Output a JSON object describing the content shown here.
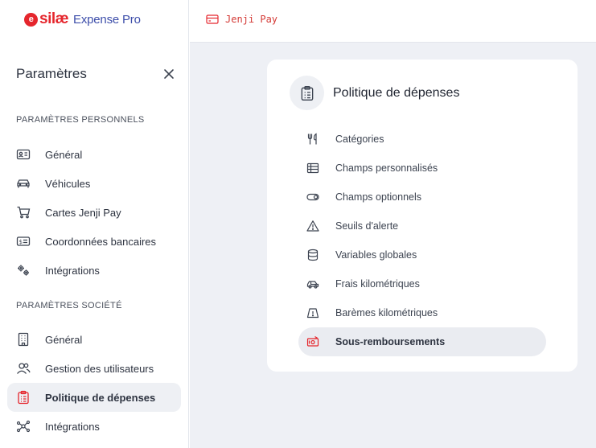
{
  "logo": {
    "mark": "silæ",
    "product": "Expense Pro"
  },
  "sidebar": {
    "title": "Paramètres",
    "personal_label": "PARAMÈTRES PERSONNELS",
    "personal_items": [
      {
        "label": "Général",
        "icon": "id-card-icon"
      },
      {
        "label": "Véhicules",
        "icon": "car-icon"
      },
      {
        "label": "Cartes Jenji Pay",
        "icon": "cart-icon"
      },
      {
        "label": "Coordonnées bancaires",
        "icon": "bank-note-icon"
      },
      {
        "label": "Intégrations",
        "icon": "gears-icon"
      }
    ],
    "company_label": "PARAMÈTRES SOCIÉTÉ",
    "company_items": [
      {
        "label": "Général",
        "icon": "building-icon"
      },
      {
        "label": "Gestion des utilisateurs",
        "icon": "users-icon"
      },
      {
        "label": "Politique de dépenses",
        "icon": "clipboard-icon",
        "active": true
      },
      {
        "label": "Intégrations",
        "icon": "network-icon"
      }
    ]
  },
  "topbar": {
    "crumb": "Jenji Pay"
  },
  "card": {
    "title": "Politique de dépenses",
    "items": [
      {
        "label": "Catégories",
        "icon": "fork-knife-icon"
      },
      {
        "label": "Champs personnalisés",
        "icon": "table-icon"
      },
      {
        "label": "Champs optionnels",
        "icon": "toggle-icon"
      },
      {
        "label": "Seuils d'alerte",
        "icon": "warning-icon"
      },
      {
        "label": "Variables globales",
        "icon": "database-icon"
      },
      {
        "label": "Frais kilométriques",
        "icon": "car-front-icon"
      },
      {
        "label": "Barèmes kilométriques",
        "icon": "car-warning-icon"
      },
      {
        "label": "Sous-remboursements",
        "icon": "money-down-icon",
        "active": true
      }
    ]
  },
  "colors": {
    "brand_red": "#e5262d",
    "brand_blue": "#3d4eaa",
    "background": "#eef0f5",
    "active_bg": "#eef0f4"
  }
}
